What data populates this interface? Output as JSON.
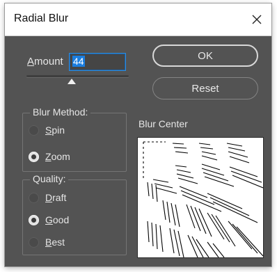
{
  "window": {
    "title": "Radial Blur"
  },
  "amount": {
    "label": "Amount",
    "value": "44",
    "range_max": 100
  },
  "buttons": {
    "ok": "OK",
    "reset": "Reset"
  },
  "blur_method": {
    "legend": "Blur Method:",
    "options": [
      "Spin",
      "Zoom"
    ],
    "selected": "Zoom"
  },
  "quality": {
    "legend": "Quality:",
    "options": [
      "Draft",
      "Good",
      "Best"
    ],
    "selected": "Good"
  },
  "blur_center": {
    "label": "Blur Center"
  },
  "colors": {
    "dialog_bg": "#535353",
    "title_bg": "#ffffff",
    "text": "#e6e6e6",
    "focus_blue": "#1b7ee0"
  },
  "icons": {
    "close": "close-icon",
    "slider_thumb": "slider-thumb-icon"
  }
}
